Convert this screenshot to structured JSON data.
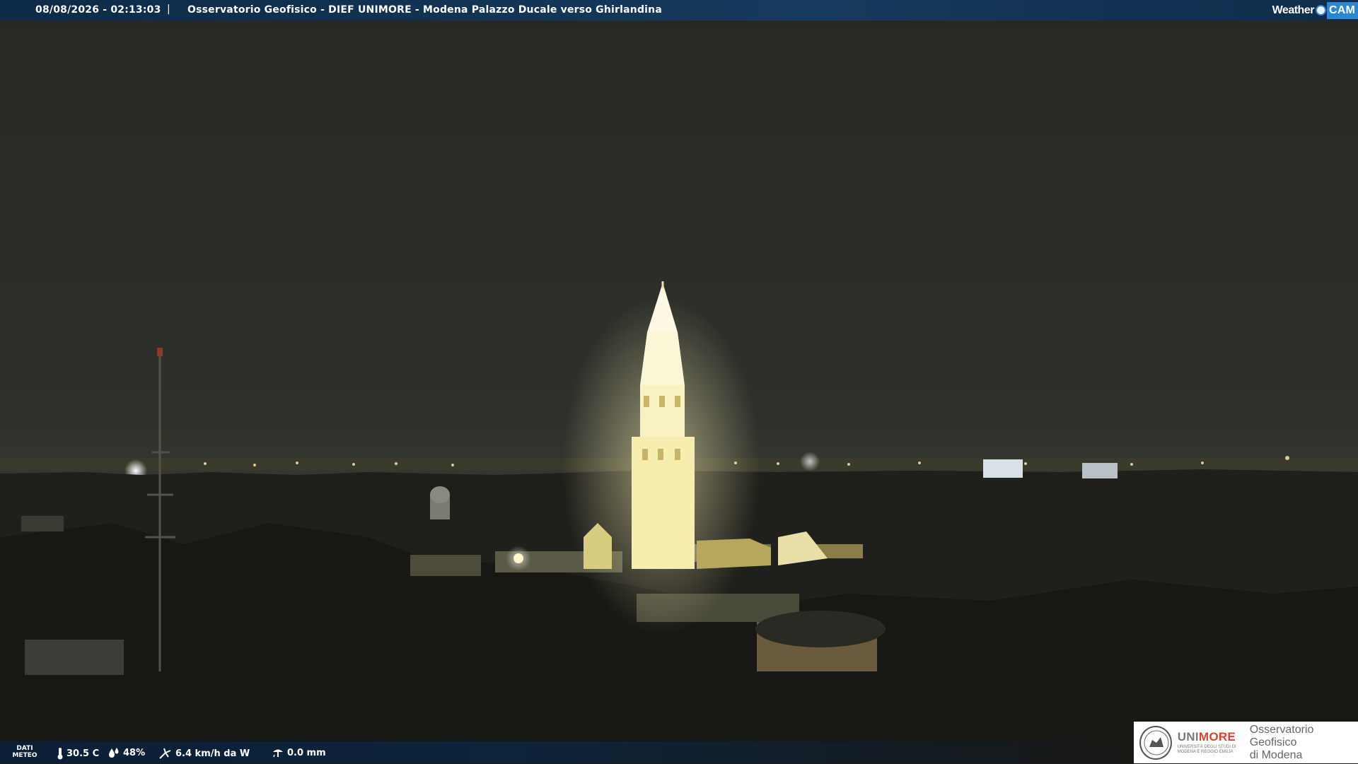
{
  "header": {
    "timestamp": "08/08/2026 - 02:13:03",
    "separator": "|",
    "title": "Osservatorio Geofisico - DIEF UNIMORE - Modena Palazzo Ducale verso Ghirlandina",
    "logo_weather": "Weather",
    "logo_cam": "CAM"
  },
  "weather_bar": {
    "dati_label": "DATI",
    "meteo_label": "METEO",
    "temperature": "30.5 C",
    "humidity": "48%",
    "wind": "6.4 km/h da W",
    "rain": "0.0 mm",
    "icons": [
      "thermometer-icon",
      "humidity-drop-icon",
      "wind-icon",
      "rain-gauge-icon"
    ]
  },
  "logo": {
    "brand_grey": "UNI",
    "brand_red": "MORE",
    "brand_sub": "UNIVERSITÀ DEGLI STUDI DI MODENA E REGGIO EMILIA",
    "observatory_line1": "Osservatorio Geofisico",
    "observatory_line2": "di Modena"
  },
  "colors": {
    "banner": "#163a5e",
    "sky": "#2a2c28",
    "tower_light": "#f8f2b0",
    "accent_red": "#d8432a",
    "cam_blue": "#2b87d1"
  }
}
